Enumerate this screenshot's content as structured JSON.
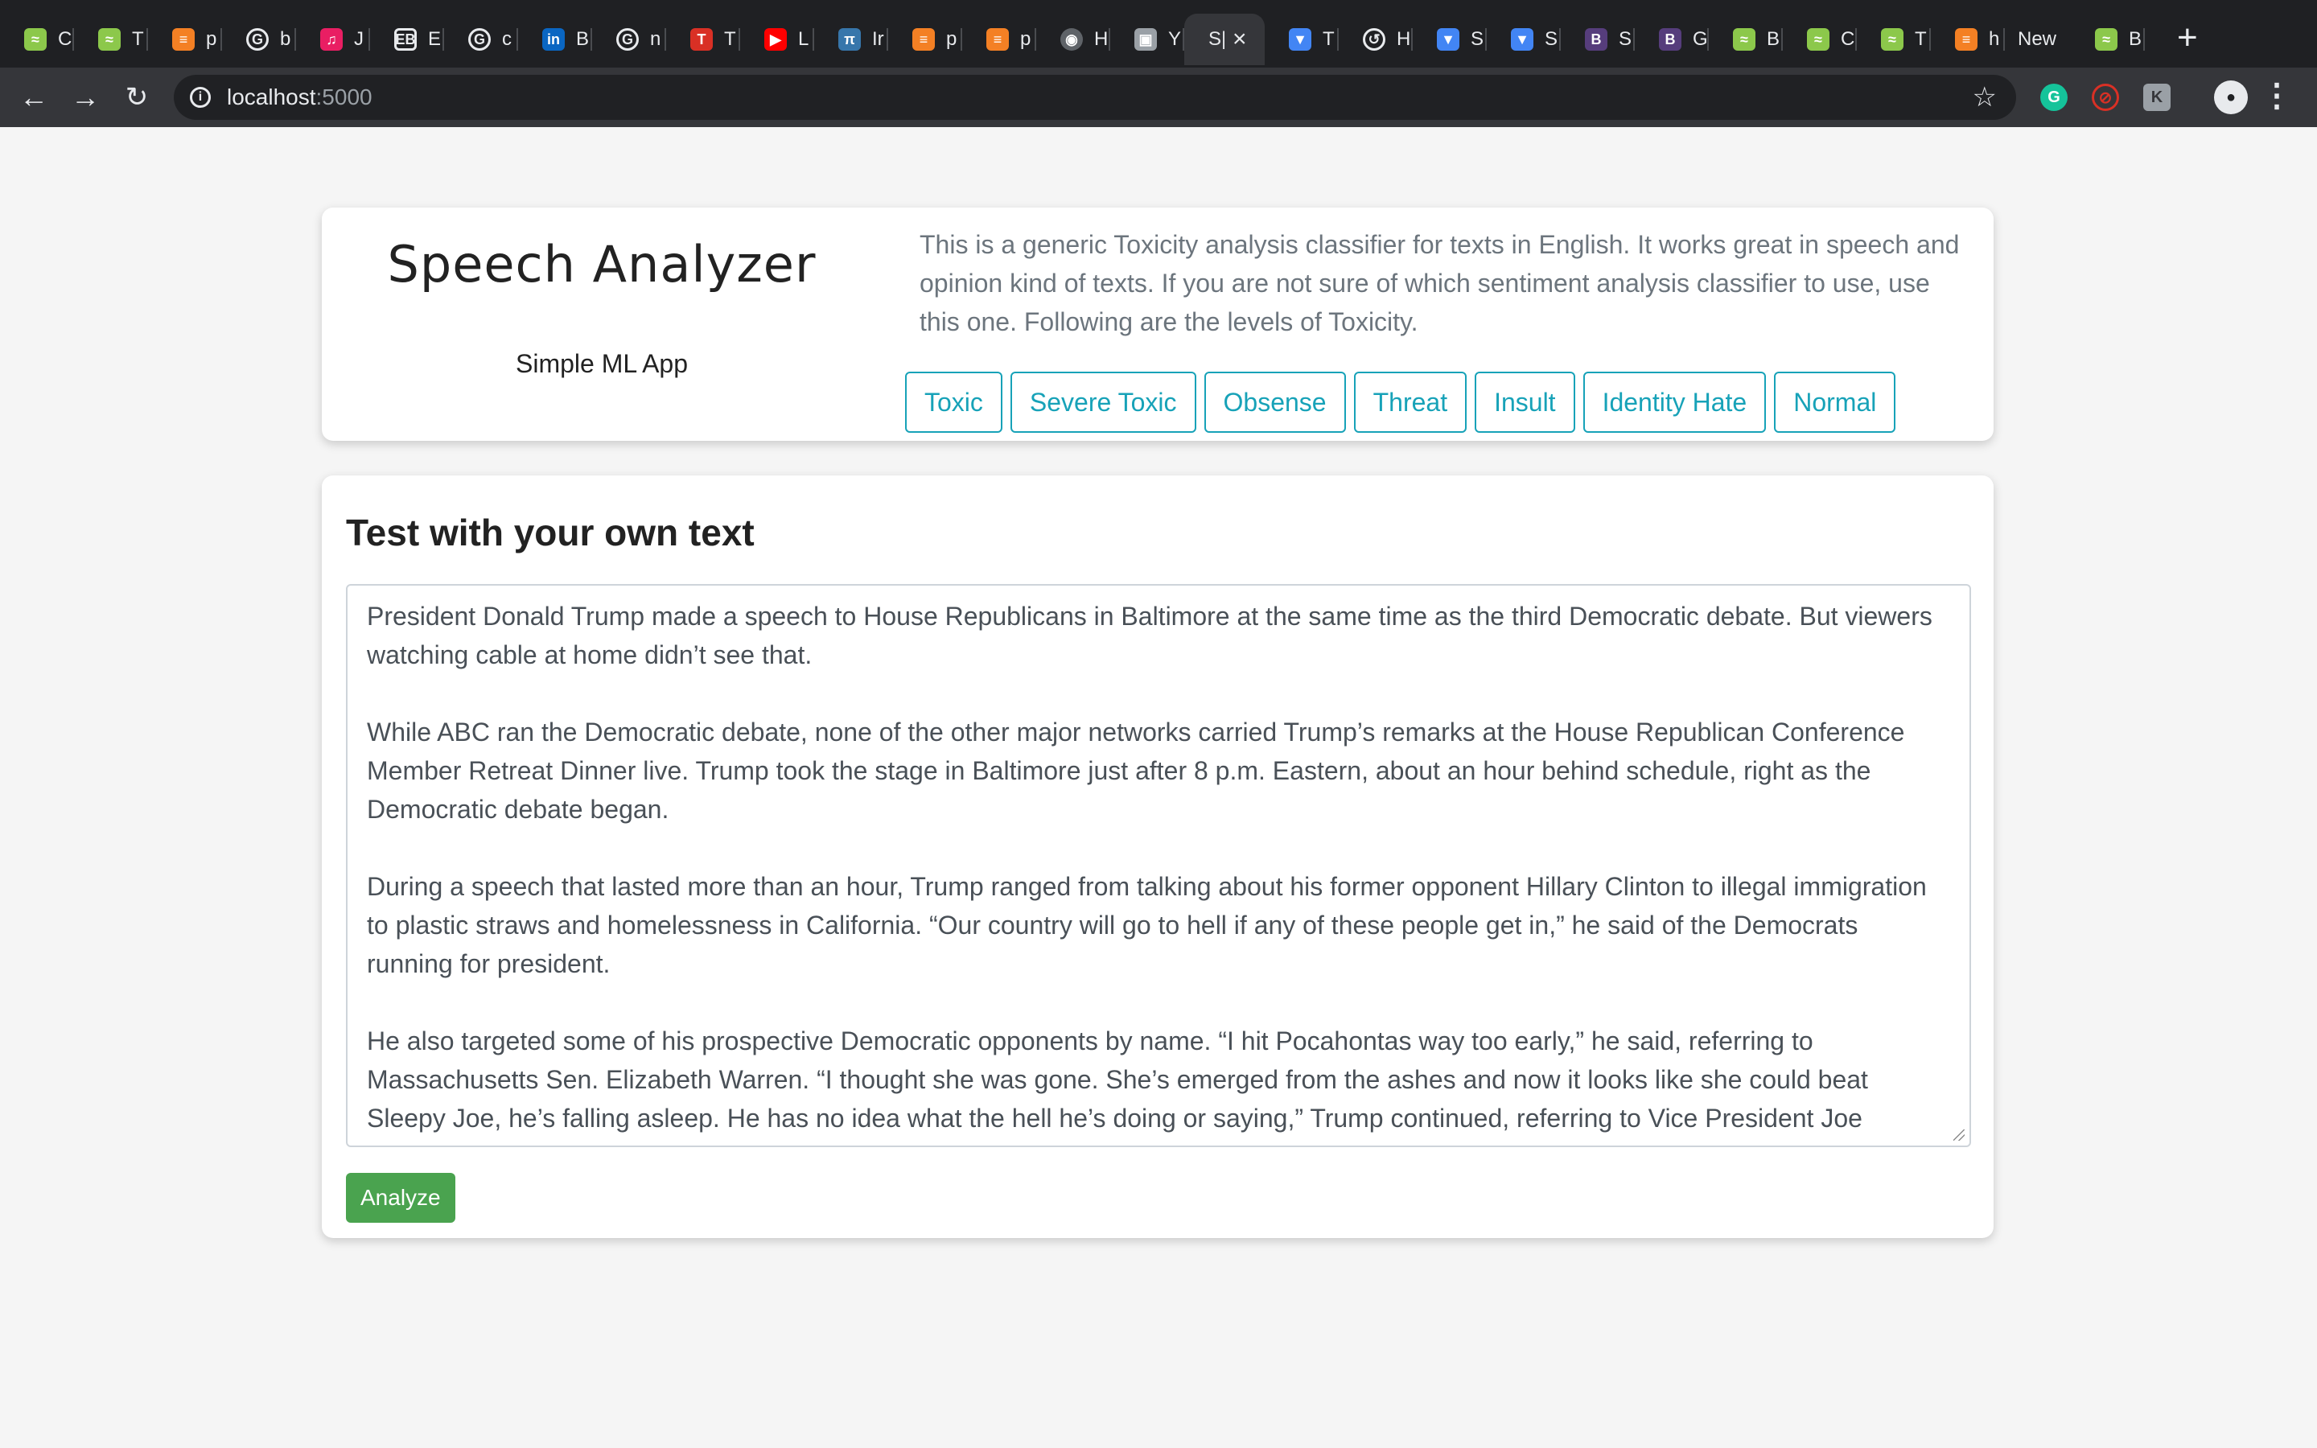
{
  "browser": {
    "tabs": [
      {
        "title": "C",
        "icon": "codeigniter-icon",
        "color": "#8cc84b"
      },
      {
        "title": "T",
        "icon": "codeigniter-icon",
        "color": "#8cc84b"
      },
      {
        "title": "p",
        "icon": "stackoverflow-icon",
        "color": "#f48024"
      },
      {
        "title": "b",
        "icon": "google-icon",
        "color": "#ffffff"
      },
      {
        "title": "J",
        "icon": "music-icon",
        "color": "#e91e63"
      },
      {
        "title": "E",
        "icon": "eb-icon",
        "color": "#ffffff"
      },
      {
        "title": "c",
        "icon": "google-icon",
        "color": "#ffffff"
      },
      {
        "title": "B",
        "icon": "linkedin-icon",
        "color": "#0a66c2"
      },
      {
        "title": "n",
        "icon": "google-icon",
        "color": "#ffffff"
      },
      {
        "title": "T",
        "icon": "t-icon",
        "color": "#d93025"
      },
      {
        "title": "L",
        "icon": "youtube-icon",
        "color": "#ff0000"
      },
      {
        "title": "Ir",
        "icon": "python-icon",
        "color": "#3776ab"
      },
      {
        "title": "p",
        "icon": "stackoverflow-icon",
        "color": "#f48024"
      },
      {
        "title": "p",
        "icon": "stackoverflow-icon",
        "color": "#f48024"
      },
      {
        "title": "H",
        "icon": "globe-icon",
        "color": "#5f6368"
      },
      {
        "title": "Y",
        "icon": "image-icon",
        "color": "#9aa0a6"
      },
      {
        "title": "S|",
        "icon": "",
        "color": "",
        "active": true
      },
      {
        "title": "T",
        "icon": "shield-icon",
        "color": "#4285f4"
      },
      {
        "title": "H",
        "icon": "history-icon",
        "color": "#e8eaed"
      },
      {
        "title": "S",
        "icon": "shield-icon",
        "color": "#4285f4"
      },
      {
        "title": "S",
        "icon": "shield-icon",
        "color": "#4285f4"
      },
      {
        "title": "S",
        "icon": "bootstrap-icon",
        "color": "#563d7c"
      },
      {
        "title": "G",
        "icon": "bootstrap-icon",
        "color": "#563d7c"
      },
      {
        "title": "B",
        "icon": "codeigniter-icon",
        "color": "#8cc84b"
      },
      {
        "title": "C",
        "icon": "codeigniter-icon",
        "color": "#8cc84b"
      },
      {
        "title": "T",
        "icon": "codeigniter-icon",
        "color": "#8cc84b"
      },
      {
        "title": "h",
        "icon": "stackoverflow-icon",
        "color": "#f48024"
      }
    ],
    "new_tab_label": "New",
    "last_tab": {
      "title": "B",
      "icon": "codeigniter-icon",
      "color": "#8cc84b"
    },
    "url_host": "localhost",
    "url_port": ":5000"
  },
  "header": {
    "title": "Speech Analyzer",
    "subtitle": "Simple ML App",
    "description": "This is a generic Toxicity analysis classifier for texts in English. It works great in speech and opinion kind of texts. If you are not sure of which sentiment analysis classifier to use, use this one. Following are the levels of Toxicity.",
    "labels": [
      "Toxic",
      "Severe Toxic",
      "Obsense",
      "Threat",
      "Insult",
      "Identity Hate",
      "Normal"
    ]
  },
  "test": {
    "title": "Test with your own text",
    "paragraphs": [
      "President Donald Trump made a speech to House Republicans in Baltimore at the same time as the third Democratic debate. But viewers watching cable at home didn’t see that.",
      "While ABC ran the Democratic debate, none of the other major networks carried Trump’s remarks at the House Republican Conference Member Retreat Dinner live. Trump took the stage in Baltimore just after 8 p.m. Eastern, about an hour behind schedule, right as the Democratic debate began.",
      "During a speech that lasted more than an hour, Trump ranged from talking about his former opponent Hillary Clinton to illegal immigration to plastic straws and homelessness in California. “Our country will go to hell if any of these people get in,” he said of the Democrats running for president.",
      "He also targeted some of his prospective Democratic opponents by name. “I hit Pocahontas way too early,” he said, referring to Massachusetts Sen. Elizabeth Warren. “I thought she was gone. She’s emerged from the ashes and now it looks like she could beat Sleepy Joe, he’s falling asleep. He has no idea what the hell he’s doing or saying,” Trump continued, referring to Vice President Joe"
    ],
    "analyze_label": "Analyze"
  }
}
